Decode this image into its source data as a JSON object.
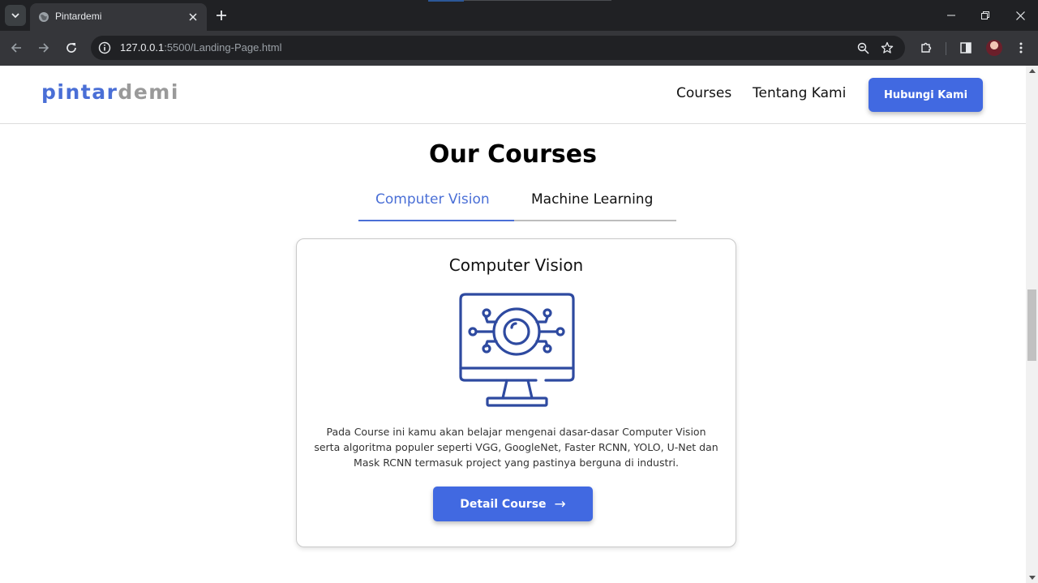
{
  "browser": {
    "tab_title": "Pintardemi",
    "url_host": "127.0.0.1",
    "url_rest": ":5500/Landing-Page.html",
    "icons": [
      "tab-search-icon",
      "globe-icon",
      "close-icon",
      "plus-icon",
      "minimize-icon",
      "restore-icon",
      "close-window-icon",
      "back-icon",
      "forward-icon",
      "reload-icon",
      "info-icon",
      "zoom-icon",
      "star-icon",
      "extensions-icon",
      "side-panel-icon",
      "profile-avatar",
      "kebab-menu-icon"
    ]
  },
  "site": {
    "logo_part1": "pintar",
    "logo_part2": "demi",
    "logo_colors": {
      "part1": "#4a6fd6",
      "part2": "#9a9a9a"
    },
    "nav": {
      "courses": "Courses",
      "about": "Tentang Kami",
      "contact": "Hubungi Kami"
    },
    "accent_color": "#4169e1"
  },
  "courses": {
    "title": "Our Courses",
    "tabs": [
      {
        "label": "Computer Vision",
        "active": true
      },
      {
        "label": "Machine Learning",
        "active": false
      }
    ],
    "card": {
      "title": "Computer Vision",
      "icon": "monitor-eye-circuit-icon",
      "description": "Pada Course ini kamu akan belajar mengenai dasar-dasar Computer Vision serta algoritma populer seperti VGG, GoogleNet, Faster RCNN, YOLO, U-Net dan Mask RCNN termasuk project yang pastinya berguna di industri.",
      "button_label": "Detail Course",
      "button_arrow": "→"
    }
  }
}
